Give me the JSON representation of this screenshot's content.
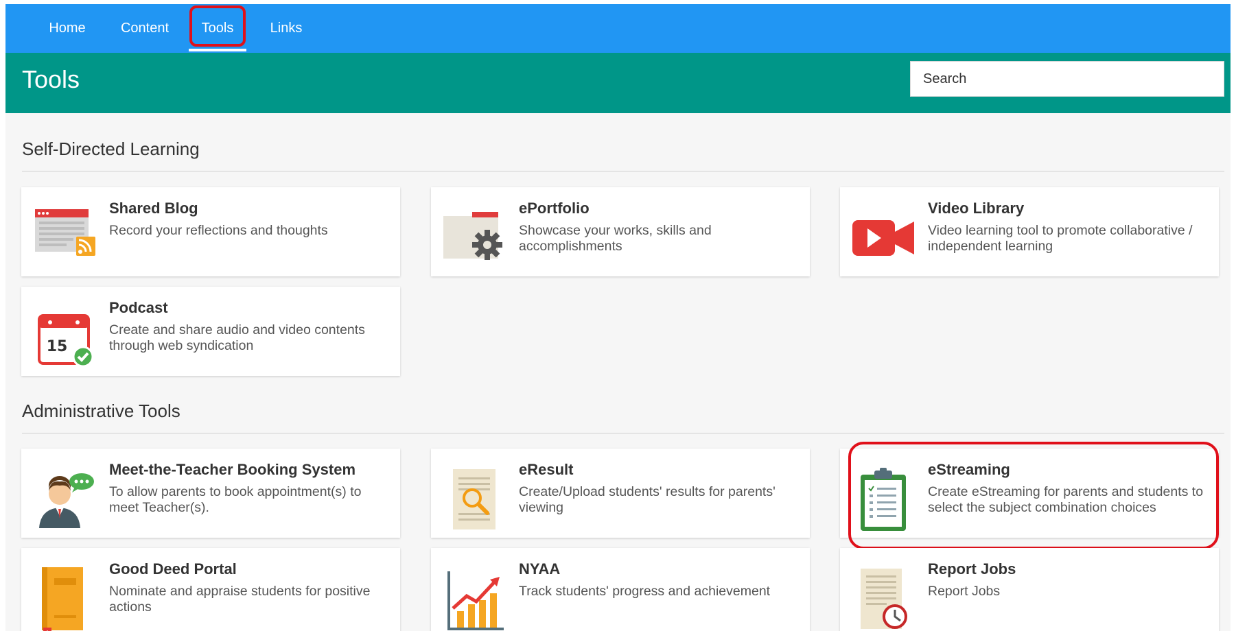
{
  "nav": {
    "items": [
      {
        "label": "Home"
      },
      {
        "label": "Content"
      },
      {
        "label": "Tools"
      },
      {
        "label": "Links"
      }
    ],
    "active": "Tools"
  },
  "header": {
    "title": "Tools",
    "search_placeholder": "Search"
  },
  "sections": [
    {
      "title": "Self-Directed Learning",
      "cards": [
        {
          "title": "Shared Blog",
          "desc": "Record your reflections and thoughts",
          "icon": "blog-icon"
        },
        {
          "title": "ePortfolio",
          "desc": "Showcase your works, skills and accomplishments",
          "icon": "portfolio-icon"
        },
        {
          "title": "Video Library",
          "desc": "Video learning tool to promote collaborative / independent learning",
          "icon": "video-camera-icon"
        },
        {
          "title": "Podcast",
          "desc": "Create and share audio and video contents through web syndication",
          "icon": "calendar-icon"
        }
      ]
    },
    {
      "title": "Administrative Tools",
      "cards": [
        {
          "title": "Meet-the-Teacher Booking System",
          "desc": "To allow parents to book appointment(s) to meet Teacher(s).",
          "icon": "teacher-icon"
        },
        {
          "title": "eResult",
          "desc": "Create/Upload students' results for parents' viewing",
          "icon": "document-search-icon"
        },
        {
          "title": "eStreaming",
          "desc": "Create eStreaming for parents and students to select the subject combination choices",
          "icon": "clipboard-icon"
        },
        {
          "title": "Good Deed Portal",
          "desc": "Nominate and appraise students for positive actions",
          "icon": "book-icon"
        },
        {
          "title": "NYAA",
          "desc": "Track students' progress and achievement",
          "icon": "chart-icon"
        },
        {
          "title": "Report Jobs",
          "desc": "Report Jobs",
          "icon": "report-clock-icon"
        }
      ]
    }
  ],
  "calendar_day": "15",
  "colors": {
    "nav_blue": "#2196f3",
    "header_teal": "#009688",
    "highlight_red": "#e0101a"
  }
}
